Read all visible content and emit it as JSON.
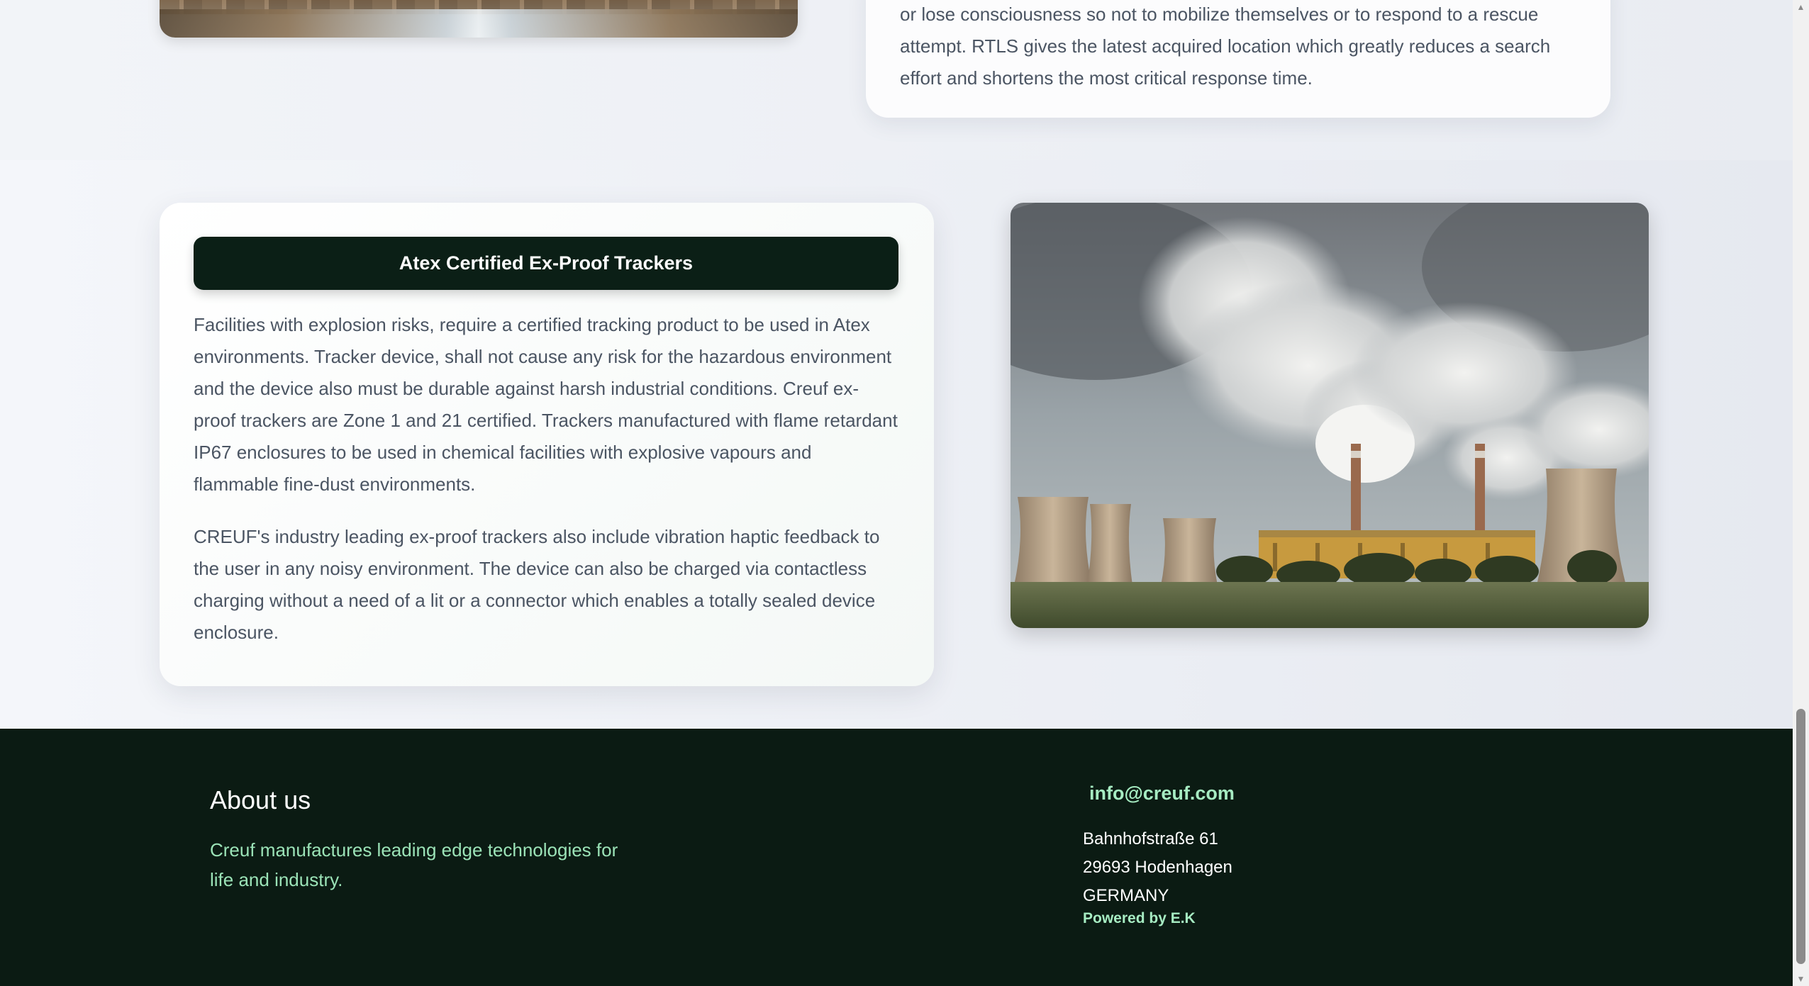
{
  "top_section": {
    "rtls_text": "or lose consciousness so not to mobilize themselves or to respond to a rescue attempt. RTLS gives the latest acquired location which greatly reduces a search effort and shortens the most critical response time."
  },
  "atex_section": {
    "title": "Atex Certified Ex-Proof Trackers",
    "paragraph_1": "Facilities with explosion risks, require a certified tracking product to be used in Atex environments. Tracker device, shall not cause any risk for the hazardous environment and the device also must be durable against harsh industrial conditions. Creuf ex-proof trackers are Zone 1 and 21 certified. Trackers manufactured with flame retardant IP67 enclosures to be used in chemical facilities with explosive vapours and flammable fine-dust environments.",
    "paragraph_2": "CREUF's industry leading ex-proof trackers also include vibration haptic feedback to the user in any noisy environment. The device can also be charged via contactless charging without a need of a lit or a connector which enables a totally sealed device enclosure."
  },
  "footer": {
    "about_title": "About us",
    "about_text": "Creuf manufactures leading edge technologies for life and industry.",
    "email": "info@creuf.com",
    "address_line_1": "Bahnhofstraße 61",
    "address_line_2": "29693 Hodenhagen",
    "address_line_3": "GERMANY",
    "powered_by": "Powered by E.K"
  }
}
